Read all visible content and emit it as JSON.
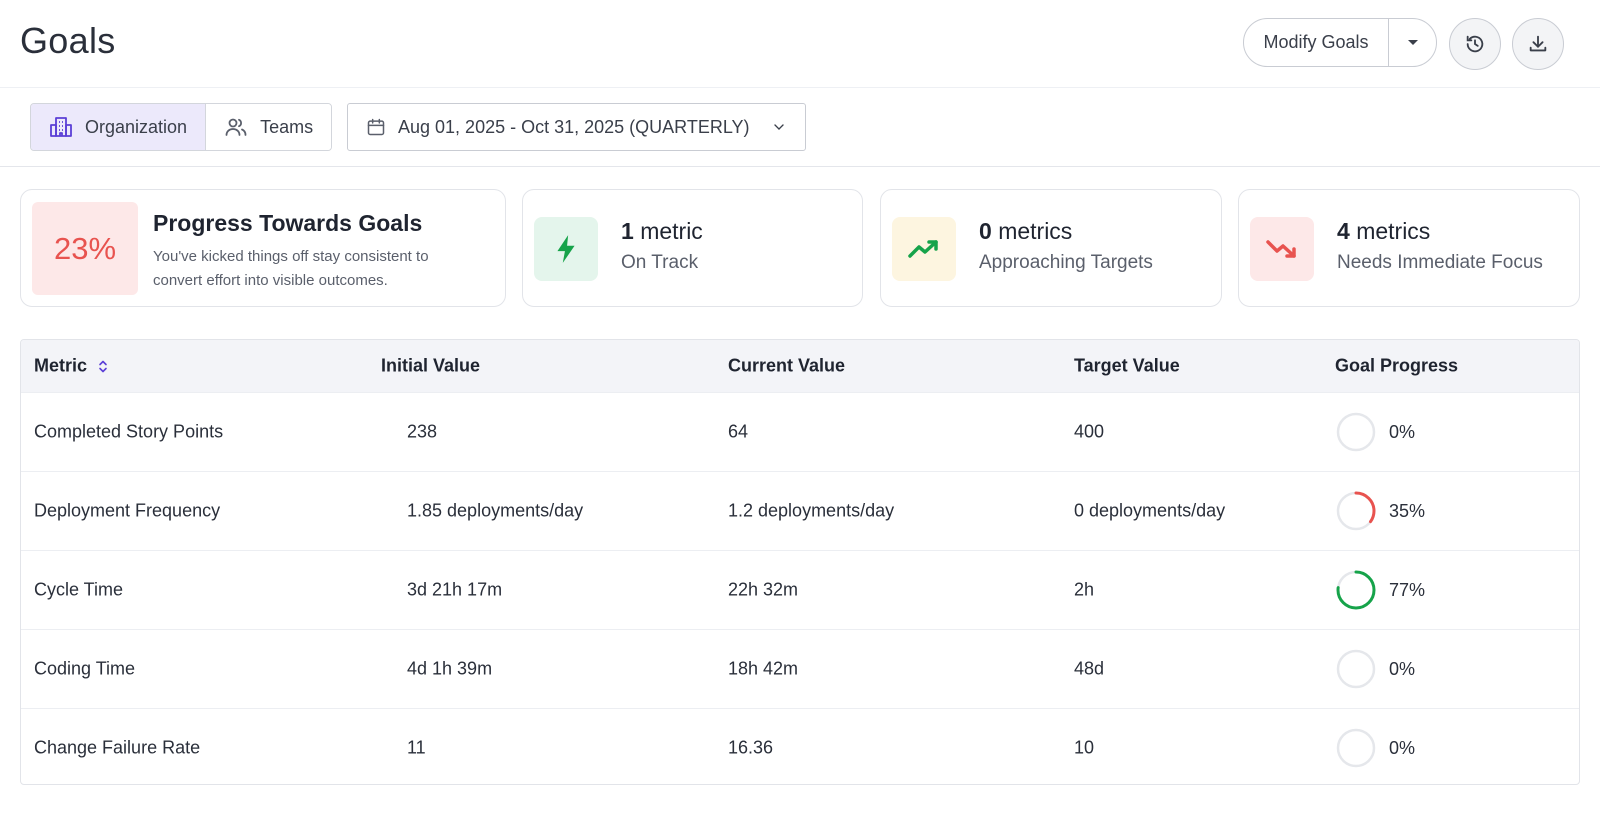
{
  "header": {
    "title": "Goals",
    "modify_label": "Modify Goals"
  },
  "filters": {
    "scope_tabs": [
      {
        "label": "Organization",
        "icon": "building-icon",
        "active": true
      },
      {
        "label": "Teams",
        "icon": "users-icon",
        "active": false
      }
    ],
    "date_range": "Aug 01, 2025 - Oct 31, 2025 (QUARTERLY)"
  },
  "summary": {
    "progress": {
      "percent": "23%",
      "title": "Progress Towards Goals",
      "description": "You've kicked things off stay consistent to convert effort into visible outcomes."
    },
    "on_track": {
      "count": "1",
      "unit": "metric",
      "label": "On Track",
      "icon": "lightning-icon"
    },
    "approaching": {
      "count": "0",
      "unit": "metrics",
      "label": "Approaching Targets",
      "icon": "trend-up-icon"
    },
    "needs_focus": {
      "count": "4",
      "unit": "metrics",
      "label": "Needs Immediate Focus",
      "icon": "trend-down-icon"
    }
  },
  "table": {
    "headers": {
      "metric": "Metric",
      "initial": "Initial Value",
      "current": "Current Value",
      "target": "Target Value",
      "progress": "Goal Progress"
    },
    "rows": [
      {
        "metric": "Completed Story Points",
        "initial": "238",
        "current": "64",
        "target": "400",
        "progress_label": "0%",
        "progress": 0,
        "color": "#e8534f"
      },
      {
        "metric": "Deployment Frequency",
        "initial": "1.85 deployments/day",
        "current": "1.2 deployments/day",
        "target": "0 deployments/day",
        "progress_label": "35%",
        "progress": 0.35,
        "color": "#e8534f"
      },
      {
        "metric": "Cycle Time",
        "initial": "3d 21h 17m",
        "current": "22h 32m",
        "target": "2h",
        "progress_label": "77%",
        "progress": 0.77,
        "color": "#16a34a"
      },
      {
        "metric": "Coding Time",
        "initial": "4d 1h 39m",
        "current": "18h 42m",
        "target": "48d",
        "progress_label": "0%",
        "progress": 0,
        "color": "#e8534f"
      },
      {
        "metric": "Change Failure Rate",
        "initial": "11",
        "current": "16.36",
        "target": "10",
        "progress_label": "0%",
        "progress": 0,
        "color": "#e8534f"
      }
    ]
  },
  "colors": {
    "accent_purple": "#5b3fd6",
    "danger": "#e8534f",
    "success": "#16a34a",
    "warning_bg": "#fdf5e0"
  }
}
